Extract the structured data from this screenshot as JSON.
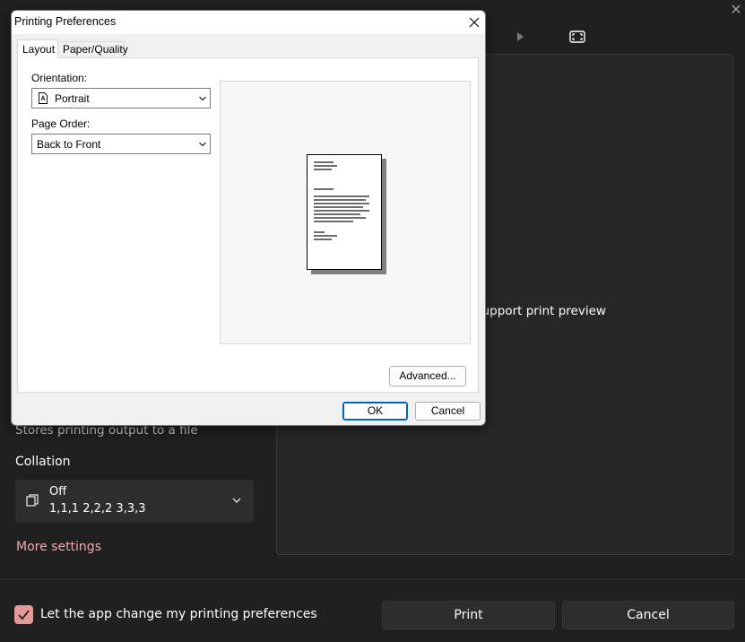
{
  "background": {
    "preview_message": "t support print preview",
    "file_description": "Stores printing output to a file",
    "collation": {
      "label": "Collation",
      "value": "Off",
      "sub": "1,1,1  2,2,2  3,3,3"
    },
    "more_settings": "More settings",
    "pref_checkbox_label": "Let the app change my printing preferences",
    "print_button": "Print",
    "cancel_button": "Cancel",
    "accent": "#e59a9a"
  },
  "dialog": {
    "title": "Printing Preferences",
    "tabs": [
      {
        "label": "Layout",
        "selected": true
      },
      {
        "label": "Paper/Quality",
        "selected": false
      }
    ],
    "orientation": {
      "label": "Orientation:",
      "value": "Portrait"
    },
    "page_order": {
      "label": "Page Order:",
      "value": "Back to Front"
    },
    "advanced_button": "Advanced...",
    "ok_button": "OK",
    "cancel_button": "Cancel"
  }
}
